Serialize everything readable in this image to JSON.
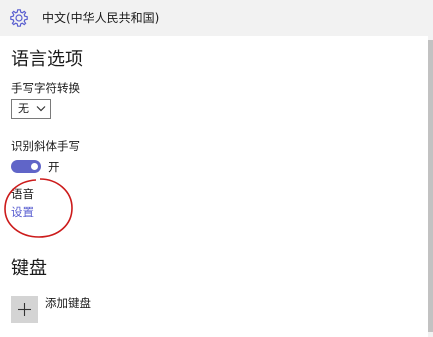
{
  "header": {
    "title": "中文(中华人民共和国)",
    "icon": "gear-icon"
  },
  "language_options": {
    "title": "语言选项",
    "handwriting": {
      "label": "手写字符转换",
      "selected": "无"
    },
    "italic_recognition": {
      "label": "识别斜体手写",
      "state_label": "开",
      "on": true
    },
    "speech": {
      "label": "语音",
      "settings_link": "设置"
    }
  },
  "keyboard": {
    "title": "键盘",
    "add_label": "添加键盘"
  },
  "colors": {
    "accent": "#6065c8",
    "link": "#5a5fd0",
    "annotation": "#cc1b1b",
    "header_bg": "#f2f2f2"
  }
}
